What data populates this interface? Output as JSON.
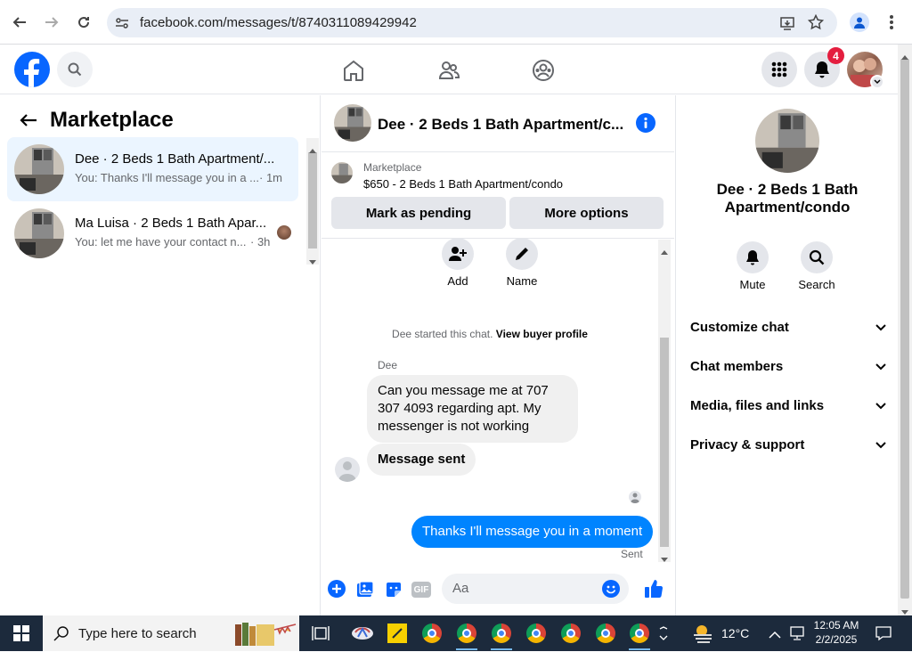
{
  "browser": {
    "url": "facebook.com/messages/t/8740311089429942"
  },
  "header": {
    "notification_count": "4"
  },
  "left": {
    "title": "Marketplace",
    "conversations": [
      {
        "title": "Dee · 2 Beds 1 Bath Apartment/...",
        "preview": "You: Thanks I'll message you in a ...",
        "time": "· 1m"
      },
      {
        "title": "Ma Luisa · 2 Beds 1 Bath Apar...",
        "preview": "You: let me have your contact n...",
        "time": "· 3h"
      }
    ]
  },
  "chat": {
    "title": "Dee · 2 Beds 1 Bath Apartment/c...",
    "listing_source": "Marketplace",
    "listing_title": "$650 - 2 Beds 1 Bath Apartment/condo",
    "mark_pending": "Mark as pending",
    "more_options": "More options",
    "add_label": "Add",
    "name_label": "Name",
    "started_text": "Dee started this chat.",
    "view_profile": "View buyer profile",
    "sender_name": "Dee",
    "msg1": "Can you message me at 707 307 4093 regarding apt. My messenger is not working",
    "msg2": "Message sent",
    "my_msg": "Thanks I'll message you in a moment",
    "status": "Sent",
    "composer_placeholder": "Aa"
  },
  "right": {
    "title": "Dee · 2 Beds 1 Bath Apartment/condo",
    "mute": "Mute",
    "search": "Search",
    "sections": [
      "Customize chat",
      "Chat members",
      "Media, files and links",
      "Privacy & support"
    ]
  },
  "taskbar": {
    "search_placeholder": "Type here to search",
    "temperature": "12°C",
    "time": "12:05 AM",
    "date": "2/2/2025"
  },
  "colors": {
    "accent": "#0866ff",
    "bubble_blue": "#0084ff",
    "notification_red": "#e41e3f"
  }
}
